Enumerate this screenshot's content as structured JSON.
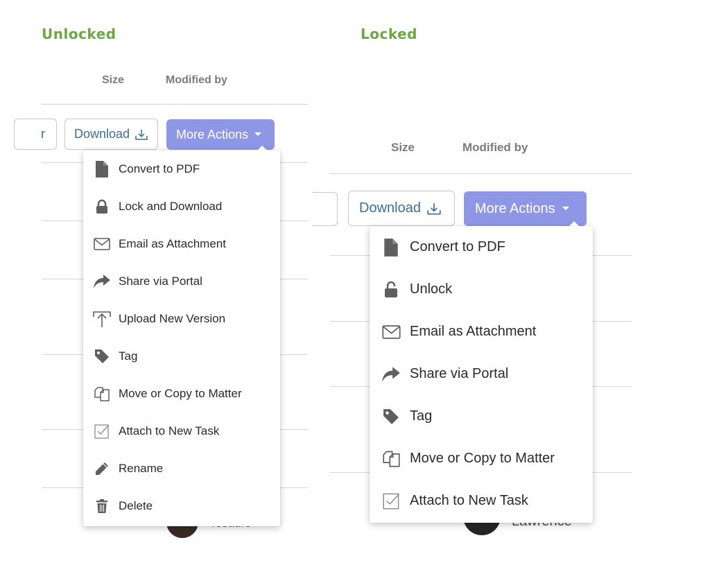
{
  "unlocked": {
    "title": "Unlocked",
    "columns": {
      "size": "Size",
      "modified_by": "Modified by"
    },
    "partial_button_label": "r",
    "download_label": "Download",
    "more_actions_label": "More Actions",
    "menu_items": [
      {
        "label": "Convert to PDF",
        "icon": "document-icon"
      },
      {
        "label": "Lock and Download",
        "icon": "lock-icon"
      },
      {
        "label": "Email as Attachment",
        "icon": "envelope-icon"
      },
      {
        "label": "Share via Portal",
        "icon": "share-arrow-icon"
      },
      {
        "label": "Upload New Version",
        "icon": "upload-icon"
      },
      {
        "label": "Tag",
        "icon": "tag-icon"
      },
      {
        "label": "Move or Copy to Matter",
        "icon": "copy-icon"
      },
      {
        "label": "Attach to New Task",
        "icon": "checkbox-icon"
      },
      {
        "label": "Rename",
        "icon": "pencil-icon"
      },
      {
        "label": "Delete",
        "icon": "trash-icon"
      }
    ],
    "avatar_name_partial": "Tesauro"
  },
  "locked": {
    "title": "Locked",
    "columns": {
      "size": "Size",
      "modified_by": "Modified by"
    },
    "download_label": "Download",
    "more_actions_label": "More Actions",
    "menu_items": [
      {
        "label": "Convert to PDF",
        "icon": "document-icon"
      },
      {
        "label": "Unlock",
        "icon": "unlock-icon"
      },
      {
        "label": "Email as Attachment",
        "icon": "envelope-icon"
      },
      {
        "label": "Share via Portal",
        "icon": "share-arrow-icon"
      },
      {
        "label": "Tag",
        "icon": "tag-icon"
      },
      {
        "label": "Move or Copy to Matter",
        "icon": "copy-icon"
      },
      {
        "label": "Attach to New Task",
        "icon": "checkbox-icon"
      }
    ],
    "avatar_name_partial": "Lawrence"
  },
  "colors": {
    "title_green": "#6aa842",
    "primary_button": "#8e97e6",
    "download_text": "#3b6d95",
    "icon_gray": "#5f5f5f"
  }
}
